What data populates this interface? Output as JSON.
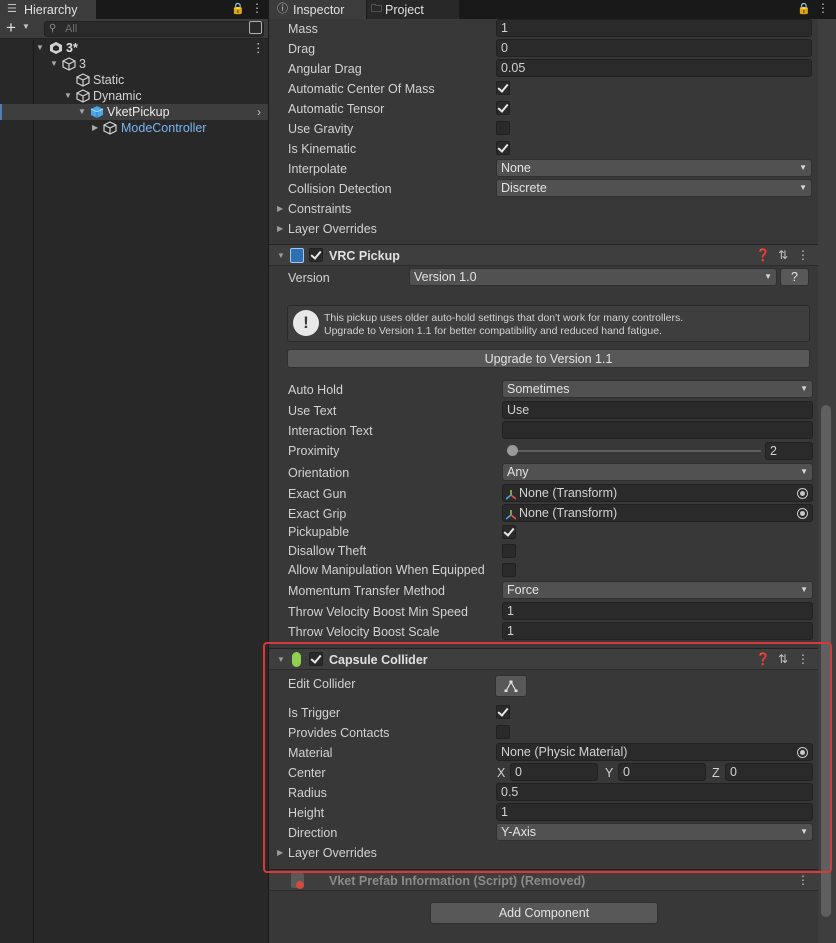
{
  "hierarchy": {
    "tab_label": "Hierarchy",
    "search_placeholder": "All",
    "items": [
      {
        "label": "3*"
      },
      {
        "label": "3"
      },
      {
        "label": "Static"
      },
      {
        "label": "Dynamic"
      },
      {
        "label": "VketPickup"
      },
      {
        "label": "ModeController"
      }
    ]
  },
  "inspector": {
    "tabs": [
      {
        "label": "Inspector"
      },
      {
        "label": "Project"
      }
    ],
    "rigidbody": {
      "mass": {
        "label": "Mass",
        "value": "1"
      },
      "drag": {
        "label": "Drag",
        "value": "0"
      },
      "angular_drag": {
        "label": "Angular Drag",
        "value": "0.05"
      },
      "auto_center": {
        "label": "Automatic Center Of Mass",
        "checked": true
      },
      "auto_tensor": {
        "label": "Automatic Tensor",
        "checked": true
      },
      "use_gravity": {
        "label": "Use Gravity",
        "checked": false
      },
      "is_kinematic": {
        "label": "Is Kinematic",
        "checked": true
      },
      "interpolate": {
        "label": "Interpolate",
        "value": "None"
      },
      "collision_detection": {
        "label": "Collision Detection",
        "value": "Discrete"
      },
      "constraints": {
        "label": "Constraints"
      },
      "layer_overrides": {
        "label": "Layer Overrides"
      }
    },
    "vrc_pickup": {
      "title": "VRC Pickup",
      "version_label": "Version",
      "version_value": "Version 1.0",
      "help_button": "?",
      "warning_line1": "This pickup uses older auto-hold settings that don't work for many controllers.",
      "warning_line2": "Upgrade to Version 1.1 for better compatibility and reduced hand fatigue.",
      "upgrade_button": "Upgrade to Version 1.1",
      "auto_hold": {
        "label": "Auto Hold",
        "value": "Sometimes"
      },
      "use_text": {
        "label": "Use Text",
        "value": "Use"
      },
      "interaction_text": {
        "label": "Interaction Text",
        "value": ""
      },
      "proximity": {
        "label": "Proximity",
        "value": "2",
        "slider_fraction": 0.0
      },
      "orientation": {
        "label": "Orientation",
        "value": "Any"
      },
      "exact_gun": {
        "label": "Exact Gun",
        "value": "None (Transform)"
      },
      "exact_grip": {
        "label": "Exact Grip",
        "value": "None (Transform)"
      },
      "pickupable": {
        "label": "Pickupable",
        "checked": true
      },
      "disallow_theft": {
        "label": "Disallow Theft",
        "checked": false
      },
      "allow_manipulation": {
        "label": "Allow Manipulation When Equipped",
        "checked": false
      },
      "momentum_method": {
        "label": "Momentum Transfer Method",
        "value": "Force"
      },
      "throw_min_speed": {
        "label": "Throw Velocity Boost Min Speed",
        "value": "1"
      },
      "throw_scale": {
        "label": "Throw Velocity Boost Scale",
        "value": "1"
      }
    },
    "capsule_collider": {
      "title": "Capsule Collider",
      "edit_collider": {
        "label": "Edit Collider"
      },
      "is_trigger": {
        "label": "Is Trigger",
        "checked": true
      },
      "provides_contacts": {
        "label": "Provides Contacts",
        "checked": false
      },
      "material": {
        "label": "Material",
        "value": "None (Physic Material)"
      },
      "center": {
        "label": "Center",
        "x_label": "X",
        "x": "0",
        "y_label": "Y",
        "y": "0",
        "z_label": "Z",
        "z": "0"
      },
      "radius": {
        "label": "Radius",
        "value": "0.5"
      },
      "height": {
        "label": "Height",
        "value": "1"
      },
      "direction": {
        "label": "Direction",
        "value": "Y-Axis"
      },
      "layer_overrides": {
        "label": "Layer Overrides"
      }
    },
    "removed_script": {
      "title": "Vket Prefab Information (Script) (Removed)"
    },
    "add_component": "Add Component"
  },
  "colors": {
    "highlight": "#d9373a",
    "link_blue": "#7ab5f0",
    "prefab_blue": "#7ab5f0"
  }
}
